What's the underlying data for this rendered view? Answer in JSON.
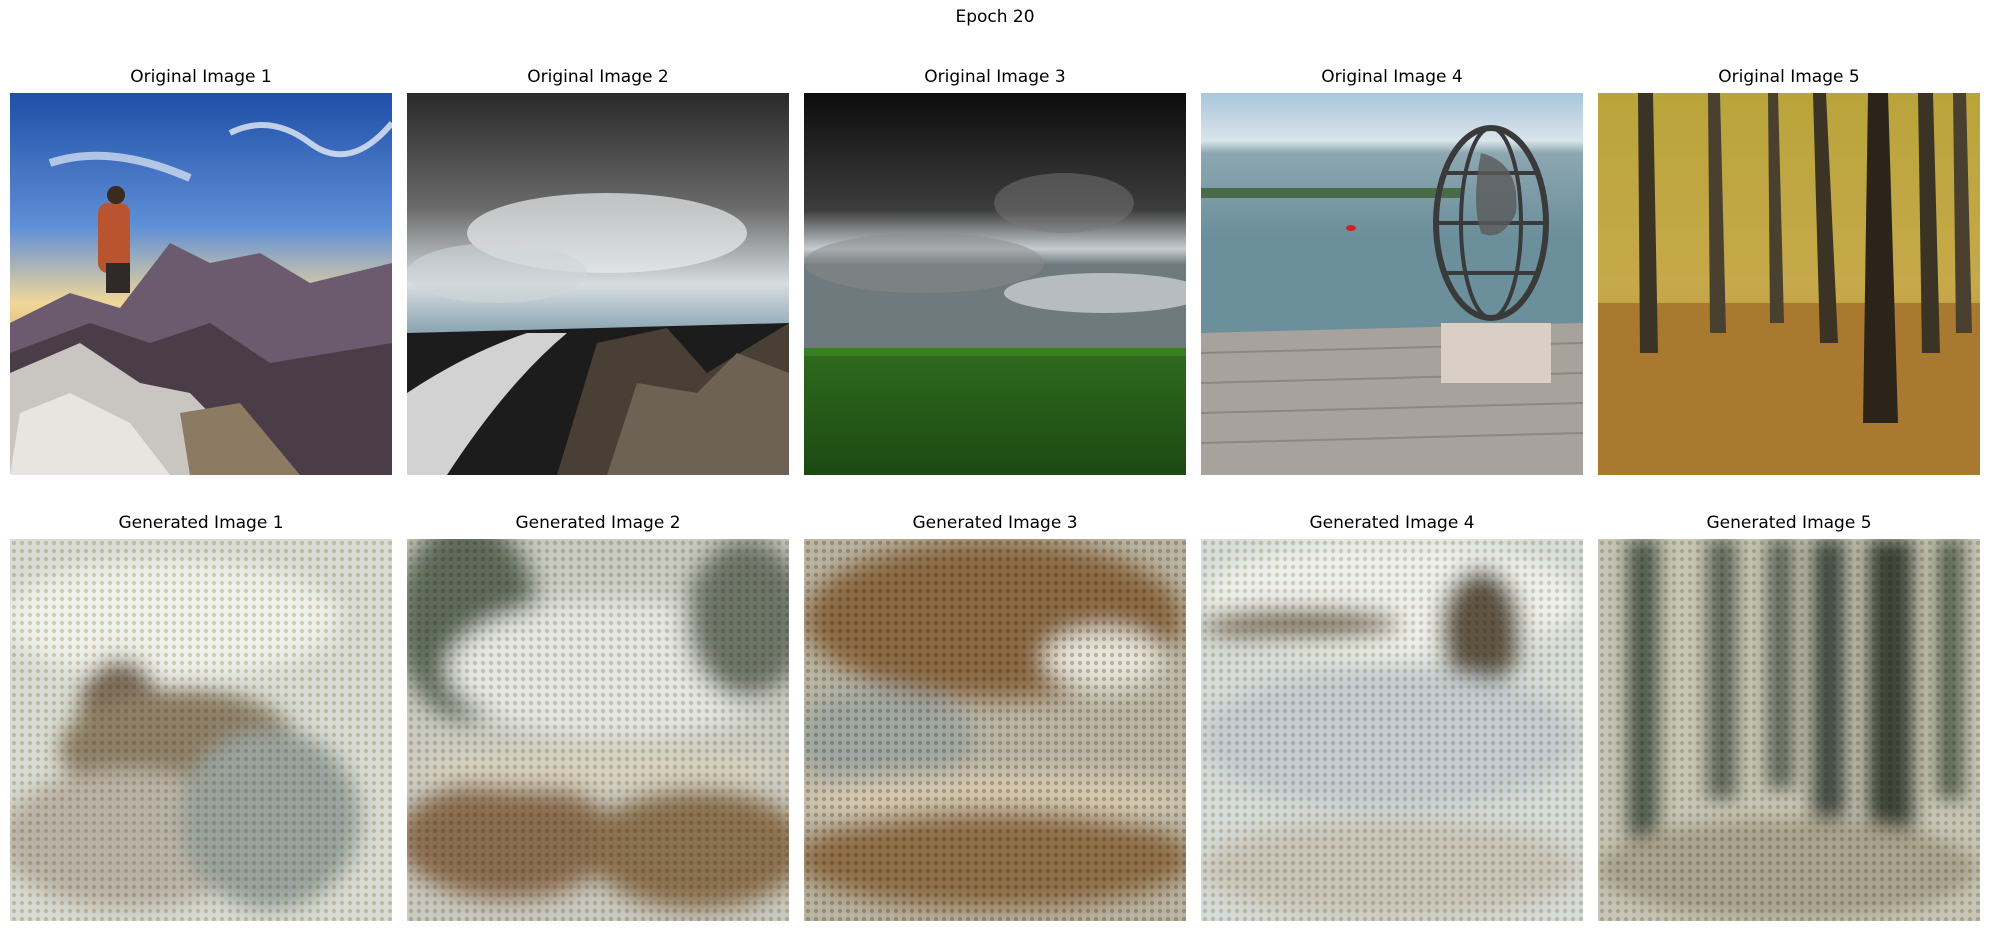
{
  "figure": {
    "title": "Epoch 20"
  },
  "originals": [
    {
      "label": "Original Image 1"
    },
    {
      "label": "Original Image 2"
    },
    {
      "label": "Original Image 3"
    },
    {
      "label": "Original Image 4"
    },
    {
      "label": "Original Image 5"
    }
  ],
  "generated": [
    {
      "label": "Generated Image 1"
    },
    {
      "label": "Generated Image 2"
    },
    {
      "label": "Generated Image 3"
    },
    {
      "label": "Generated Image 4"
    },
    {
      "label": "Generated Image 5"
    }
  ]
}
